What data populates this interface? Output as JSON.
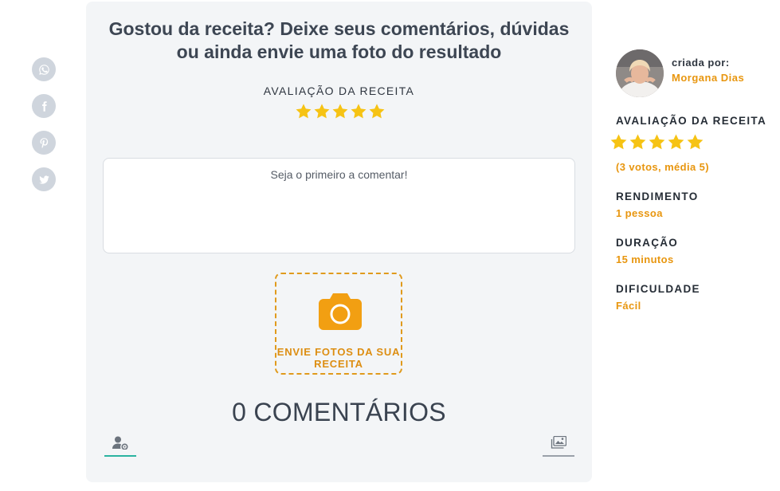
{
  "share": {
    "items": [
      {
        "name": "whatsapp-icon"
      },
      {
        "name": "facebook-icon"
      },
      {
        "name": "pinterest-icon"
      },
      {
        "name": "twitter-icon"
      }
    ]
  },
  "card": {
    "title": "Gostou da receita? Deixe seus comentários, dúvidas ou ainda envie uma foto do resultado",
    "rating_label": "AVALIAÇÃO DA RECEITA",
    "rating_value": 5,
    "comment_placeholder": "Seja o primeiro a comentar!",
    "upload_label": "ENVIE FOTOS DA SUA RECEITA",
    "comments_count": "0 COMENTÁRIOS",
    "tabs": [
      {
        "icon": "users-settings-icon",
        "active": true
      },
      {
        "icon": "photos-icon",
        "active": false
      }
    ]
  },
  "sidebar": {
    "created_by_label": "criada por:",
    "author_name": "Morgana Dias",
    "rating_label": "AVALIAÇÃO DA RECEITA",
    "rating_value": 5,
    "votes_text": "(3 votos, média 5)",
    "yield_label": "RENDIMENTO",
    "yield_value": "1 pessoa",
    "duration_label": "DURAÇÃO",
    "duration_value": "15 minutos",
    "difficulty_label": "DIFICULDADE",
    "difficulty_value": "Fácil"
  },
  "colors": {
    "accent": "#e8960f",
    "star": "#f6c314",
    "card_bg": "#f3f5f7",
    "share_bg": "#cfd5dd",
    "active_tab": "#2bb3a0"
  }
}
